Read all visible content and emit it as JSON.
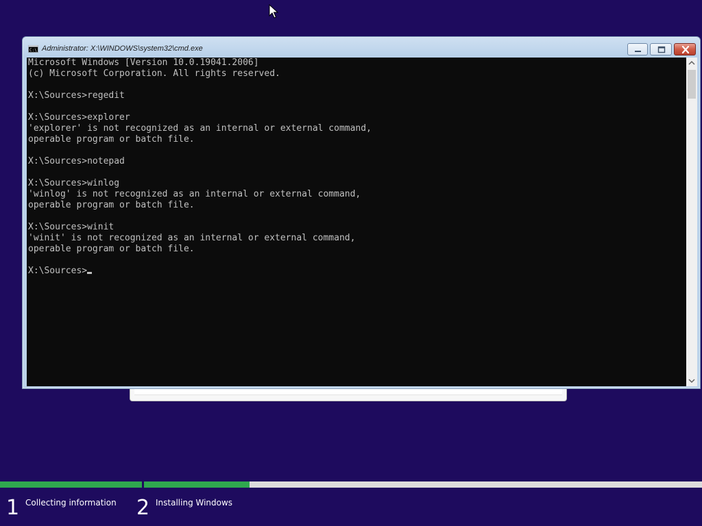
{
  "colors": {
    "desktop_background": "#1e0b5e",
    "console_background": "#0c0c0c",
    "console_text": "#c0c0c0",
    "progress_complete": "#2fa84f",
    "progress_remaining": "#dcdcdc"
  },
  "cmd_window": {
    "title": "Administrator: X:\\WINDOWS\\system32\\cmd.exe",
    "icon": "cmd-icon",
    "buttons": {
      "minimize_icon": "minimize-icon",
      "maximize_icon": "maximize-icon",
      "close_icon": "close-icon"
    },
    "console_lines": [
      "Microsoft Windows [Version 10.0.19041.2006]",
      "(c) Microsoft Corporation. All rights reserved.",
      "",
      "X:\\Sources>regedit",
      "",
      "X:\\Sources>explorer",
      "'explorer' is not recognized as an internal or external command,",
      "operable program or batch file.",
      "",
      "X:\\Sources>notepad",
      "",
      "X:\\Sources>winlog",
      "'winlog' is not recognized as an internal or external command,",
      "operable program or batch file.",
      "",
      "X:\\Sources>winit",
      "'winit' is not recognized as an internal or external command,",
      "operable program or batch file.",
      ""
    ],
    "prompt": "X:\\Sources>"
  },
  "setup_steps": [
    {
      "number": "1",
      "label": "Collecting information",
      "progress": 1.0
    },
    {
      "number": "2",
      "label": "Installing Windows",
      "progress": 0.25
    }
  ]
}
